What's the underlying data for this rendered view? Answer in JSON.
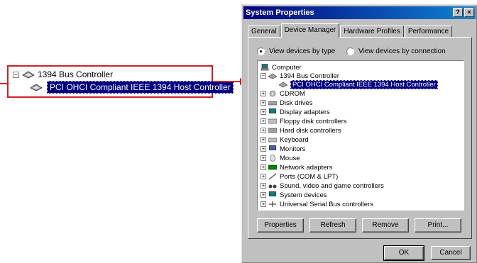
{
  "callout": {
    "parent_label": "1394 Bus Controller",
    "child_label": "PCI OHCI Compliant IEEE 1394 Host Controller"
  },
  "dialog": {
    "title": "System Properties",
    "help_button": "?",
    "close_button": "×",
    "tabs": [
      {
        "label": "General",
        "active": false
      },
      {
        "label": "Device Manager",
        "active": true
      },
      {
        "label": "Hardware Profiles",
        "active": false
      },
      {
        "label": "Performance",
        "active": false
      }
    ],
    "view_by_type": "View devices by type",
    "view_by_connection": "View devices by connection",
    "tree": {
      "root": "Computer",
      "expanded": "1394 Bus Controller",
      "selected_child": "PCI OHCI Compliant IEEE 1394 Host Controller",
      "items": [
        "CDROM",
        "Disk drives",
        "Display adapters",
        "Floppy disk controllers",
        "Hard disk controllers",
        "Keyboard",
        "Monitors",
        "Mouse",
        "Network adapters",
        "Ports (COM & LPT)",
        "Sound, video and game controllers",
        "System devices",
        "Universal Serial Bus controllers"
      ]
    },
    "buttons": {
      "properties": "Properties",
      "refresh": "Refresh",
      "remove": "Remove",
      "print": "Print...",
      "ok": "OK",
      "cancel": "Cancel"
    }
  },
  "colors": {
    "callout_border": "#d21f26",
    "selection": "#000080",
    "dialog_face": "#c0c0c0"
  }
}
